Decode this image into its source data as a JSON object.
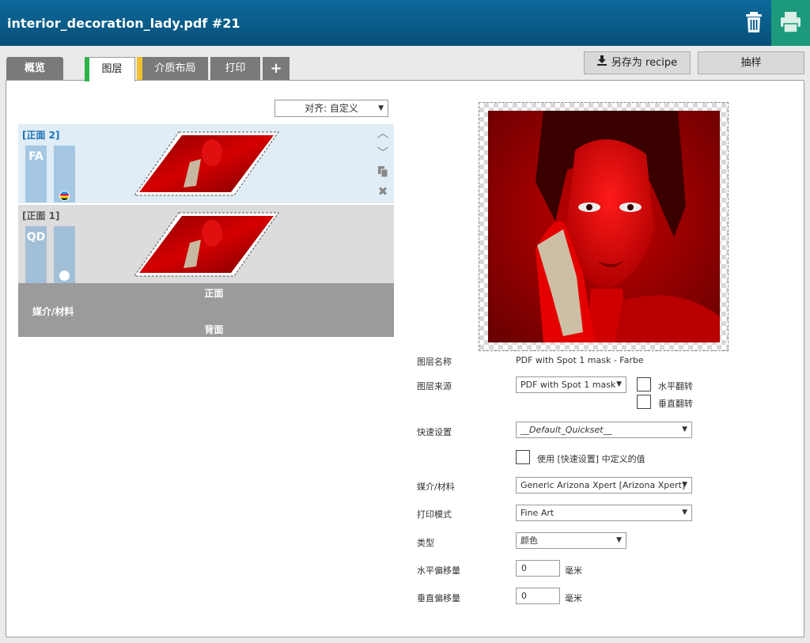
{
  "header": {
    "title": "interior_decoration_lady.pdf #21",
    "trash_icon": "trash-icon",
    "print_icon": "printer-icon"
  },
  "tabs": [
    {
      "label": "概览",
      "active": false
    },
    {
      "label": "图层",
      "active": true,
      "color": "#2db34a"
    },
    {
      "label": "介质布局",
      "active": false,
      "color": "#f2c12e"
    },
    {
      "label": "打印",
      "active": false
    },
    {
      "label": "+",
      "active": false
    }
  ],
  "toolbar": {
    "save_label": "另存为 recipe",
    "sample_label": "抽样"
  },
  "align": {
    "value": "对齐: 自定义"
  },
  "layers": [
    {
      "label": "[正面 2]",
      "code": "FA",
      "selected": true
    },
    {
      "label": "[正面 1]",
      "code": "QD",
      "selected": false
    }
  ],
  "media_band": {
    "front": "正面",
    "media": "媒介/材料",
    "back": "背面"
  },
  "properties": {
    "layer_name": {
      "label": "图层名称",
      "value": "PDF with Spot 1 mask - Farbe"
    },
    "layer_source": {
      "label": "图层来源",
      "value": "PDF with Spot 1 mask"
    },
    "flip_h": {
      "label": "水平翻转",
      "checked": false
    },
    "flip_v": {
      "label": "垂直翻转",
      "checked": false
    },
    "quickset": {
      "label": "快速设置",
      "value": "__Default_Quickset__"
    },
    "use_quickset": {
      "label": "使用 [快速设置] 中定义的值",
      "checked": false
    },
    "media": {
      "label": "媒介/材料",
      "value": "Generic Arizona Xpert [Arizona Xpert]"
    },
    "print_mode": {
      "label": "打印模式",
      "value": "Fine Art"
    },
    "type": {
      "label": "类型",
      "value": "颜色"
    },
    "h_offset": {
      "label": "水平偏移量",
      "value": "0",
      "unit": "毫米"
    },
    "v_offset": {
      "label": "垂直偏移量",
      "value": "0",
      "unit": "毫米"
    }
  }
}
